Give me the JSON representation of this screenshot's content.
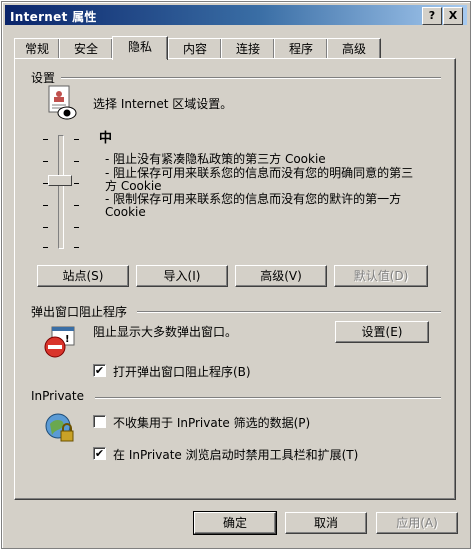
{
  "window": {
    "title_prefix": "Internet",
    "title_suffix": "属性",
    "help_btn": "?",
    "close_btn": "X"
  },
  "tabs": [
    {
      "label": "常规"
    },
    {
      "label": "安全"
    },
    {
      "label": "隐私"
    },
    {
      "label": "内容"
    },
    {
      "label": "连接"
    },
    {
      "label": "程序"
    },
    {
      "label": "高级"
    }
  ],
  "settings": {
    "group_label": "设置",
    "intro": "选择 Internet 区域设置。",
    "level": "中",
    "slider_level_fraction": 0.6,
    "descriptions": [
      "- 阻止没有紧凑隐私政策的第三方 Cookie",
      "- 阻止保存可用来联系您的信息而没有您的明确同意的第三方 Cookie",
      "- 限制保存可用来联系您的信息而没有您的默许的第一方 Cookie"
    ],
    "buttons": {
      "sites": "站点(S)",
      "import": "导入(I)",
      "advanced": "高级(V)",
      "default": "默认值(D)"
    }
  },
  "popup": {
    "group_label": "弹出窗口阻止程序",
    "text": "阻止显示大多数弹出窗口。",
    "settings_button": "设置(E)",
    "checkbox_label": "打开弹出窗口阻止程序(B)",
    "checkbox_checked": true
  },
  "inprivate": {
    "group_label": "InPrivate",
    "checkbox1_label": "不收集用于 InPrivate 筛选的数据(P)",
    "checkbox1_checked": false,
    "checkbox2_label": "在 InPrivate 浏览启动时禁用工具栏和扩展(T)",
    "checkbox2_checked": true
  },
  "footer": {
    "ok": "确定",
    "cancel": "取消",
    "apply": "应用(A)"
  },
  "check_mark": "✔"
}
